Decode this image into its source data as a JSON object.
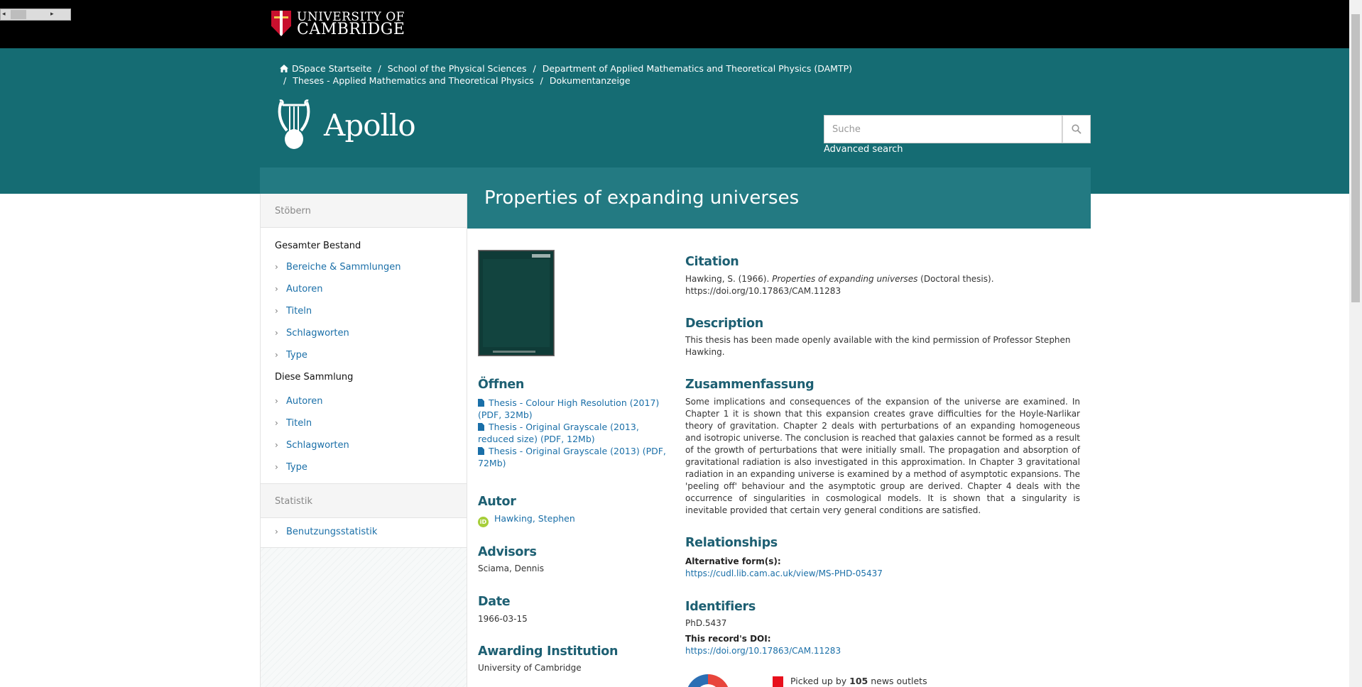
{
  "window": {
    "scroll_left_arrow": "◂",
    "scroll_right_arrow": "▸"
  },
  "brand": {
    "university_line1": "UNIVERSITY OF",
    "university_line2": "CAMBRIDGE",
    "repository_name": "Apollo"
  },
  "breadcrumb": [
    {
      "label": "DSpace Startseite"
    },
    {
      "label": "School of the Physical Sciences"
    },
    {
      "label": "Department of Applied Mathematics and Theoretical Physics (DAMTP)"
    },
    {
      "label": "Theses - Applied Mathematics and Theoretical Physics"
    },
    {
      "label": "Dokumentanzeige"
    }
  ],
  "breadcrumb_separator": "/",
  "search": {
    "placeholder": "Suche",
    "advanced_label": "Advanced search"
  },
  "sidebar": {
    "browse_heading": "Stöbern",
    "all_heading": "Gesamter Bestand",
    "all_items": [
      "Bereiche & Sammlungen",
      "Autoren",
      "Titeln",
      "Schlagworten",
      "Type"
    ],
    "collection_heading": "Diese Sammlung",
    "collection_items": [
      "Autoren",
      "Titeln",
      "Schlagworten",
      "Type"
    ],
    "stats_heading": "Statistik",
    "stats_items": [
      "Benutzungsstatistik"
    ],
    "chevron": "›"
  },
  "item": {
    "title": "Properties of expanding universes",
    "open_heading": "Öffnen",
    "files": [
      "Thesis - Colour High Resolution (2017) (PDF, 32Mb)",
      "Thesis - Original Grayscale (2013, reduced size) (PDF, 12Mb)",
      "Thesis - Original Grayscale (2013) (PDF, 72Mb)"
    ],
    "author_heading": "Autor",
    "orcid_badge": "iD",
    "author": "Hawking, Stephen",
    "advisors_heading": "Advisors",
    "advisor": "Sciama, Dennis",
    "date_heading": "Date",
    "date": "1966-03-15",
    "institution_heading": "Awarding Institution",
    "institution": "University of Cambridge",
    "citation_heading": "Citation",
    "citation_prefix": "Hawking, S. (1966). ",
    "citation_title": "Properties of expanding universes",
    "citation_suffix": " (Doctoral thesis).",
    "citation_doi": "https://doi.org/10.17863/CAM.11283",
    "description_heading": "Description",
    "description": "This thesis has been made openly available with the kind permission of Professor Stephen Hawking.",
    "abstract_heading": "Zusammenfassung",
    "abstract": "Some implications and consequences of the expansion of the universe are examined. In Chapter 1 it is shown that this expansion creates grave difficulties for the Hoyle-Narlikar theory of gravitation. Chapter 2 deals with perturbations of an expanding homogeneous and isotropic universe. The conclusion is reached that galaxies cannot be formed as a result of the growth of perturbations that were initially small. The propagation and absorption of gravitational radiation is also investigated in this approximation. In Chapter 3 gravitational radiation in an expanding universe is examined by a method of asymptotic expansions. The 'peeling off' behaviour and the asymptotic group are derived. Chapter 4 deals with the occurrence of singularities in cosmological models. It is shown that a singularity is inevitable provided that certain very general conditions are satisfied.",
    "relationships_heading": "Relationships",
    "alt_form_label": "Alternative form(s):",
    "alt_form_link": "https://cudl.lib.cam.ac.uk/view/MS-PHD-05437",
    "identifiers_heading": "Identifiers",
    "identifier": "PhD.5437",
    "record_doi_label": "This record's DOI:",
    "record_doi": "https://doi.org/10.17863/CAM.11283",
    "news_prefix": "Picked up by ",
    "news_count": "105",
    "news_suffix": " news outlets"
  },
  "colors": {
    "header_teal": "#156c73",
    "title_band": "#237a82",
    "link_blue": "#1a6fa8",
    "heading_teal": "#1d5f72"
  }
}
